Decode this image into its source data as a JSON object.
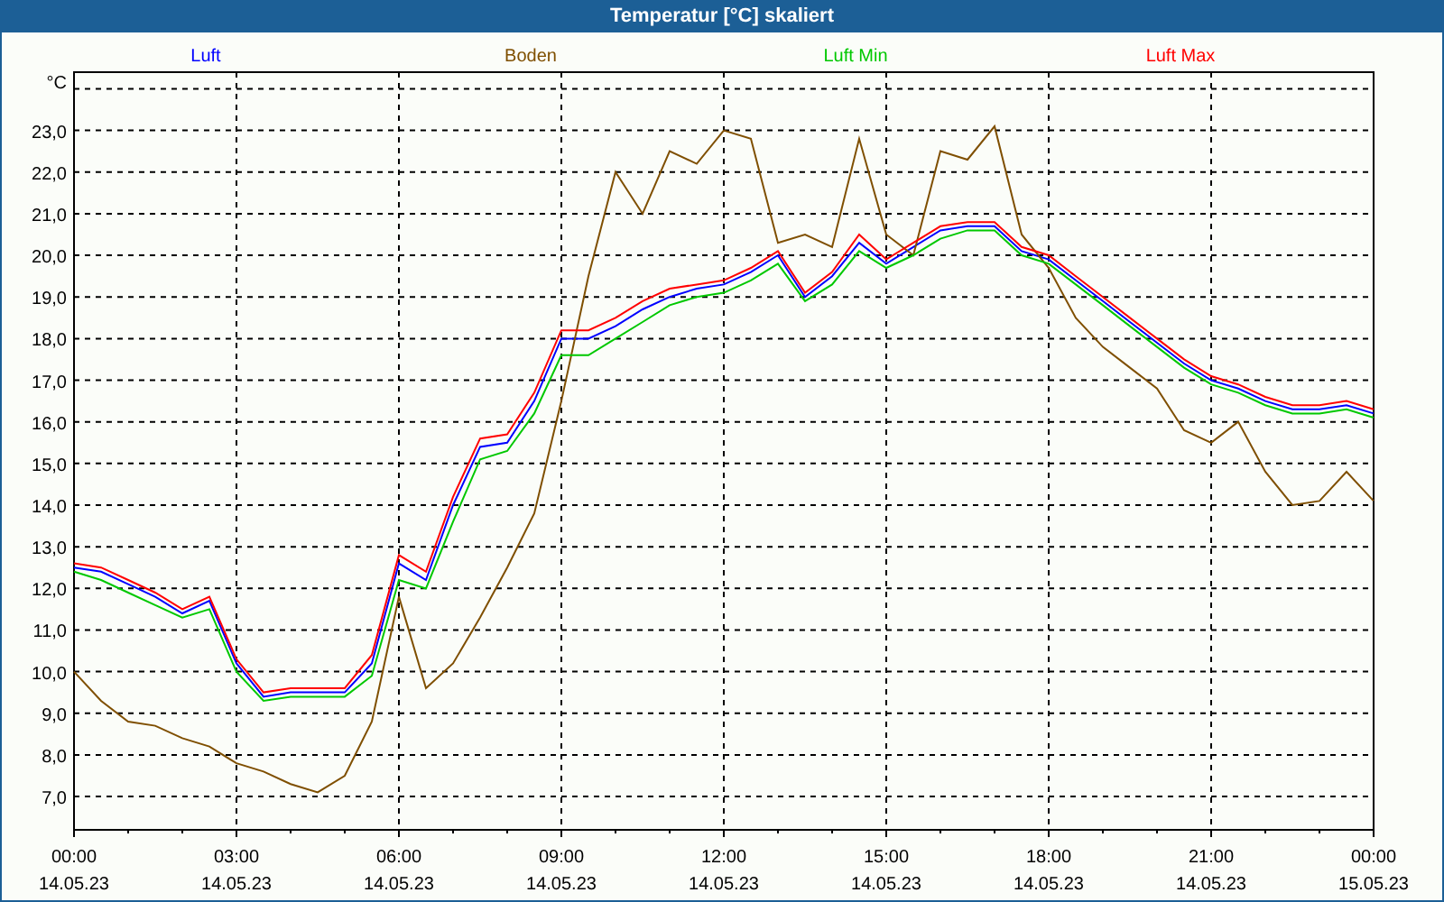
{
  "window": {
    "title": "Temperatur [°C] skaliert"
  },
  "chart_data": {
    "type": "line",
    "ylabel": "°C",
    "categories": [
      "00:00\n14.05.23",
      null,
      null,
      null,
      null,
      null,
      "03:00\n14.05.23",
      null,
      null,
      null,
      null,
      null,
      "06:00\n14.05.23",
      null,
      null,
      null,
      null,
      null,
      "09:00\n14.05.23",
      null,
      null,
      null,
      null,
      null,
      "12:00\n14.05.23",
      null,
      null,
      null,
      null,
      null,
      "15:00\n14.05.23",
      null,
      null,
      null,
      null,
      null,
      "18:00\n14.05.23",
      null,
      null,
      null,
      null,
      null,
      "21:00\n14.05.23",
      null,
      null,
      null,
      null,
      null,
      "00:00\n15.05.23"
    ],
    "series": [
      {
        "name": "Luft",
        "color": "#0000ff",
        "values": [
          12.5,
          12.4,
          12.1,
          11.8,
          11.4,
          11.7,
          10.2,
          9.4,
          9.5,
          9.5,
          9.5,
          10.2,
          12.6,
          12.2,
          14.0,
          15.4,
          15.5,
          16.5,
          18.0,
          18.0,
          18.3,
          18.7,
          19.0,
          19.2,
          19.3,
          19.6,
          20.0,
          19.0,
          19.5,
          20.3,
          19.8,
          20.2,
          20.6,
          20.7,
          20.7,
          20.1,
          19.9,
          19.4,
          18.9,
          18.4,
          17.9,
          17.4,
          17.0,
          16.8,
          16.5,
          16.3,
          16.3,
          16.4,
          16.2
        ]
      },
      {
        "name": "Boden",
        "color": "#7f4f00",
        "values": [
          10.0,
          9.3,
          8.8,
          8.7,
          8.4,
          8.2,
          7.8,
          7.6,
          7.3,
          7.1,
          7.5,
          8.8,
          11.8,
          9.6,
          10.2,
          11.3,
          12.5,
          13.8,
          16.5,
          19.5,
          22.0,
          21.0,
          22.5,
          22.2,
          23.0,
          22.8,
          20.3,
          20.5,
          20.2,
          22.8,
          20.5,
          20.0,
          22.5,
          22.3,
          23.1,
          20.5,
          19.7,
          18.5,
          17.8,
          17.3,
          16.8,
          15.8,
          15.5,
          16.0,
          14.8,
          14.0,
          14.1,
          14.8,
          14.1
        ]
      },
      {
        "name": "Luft Min",
        "color": "#00c800",
        "values": [
          12.4,
          12.2,
          11.9,
          11.6,
          11.3,
          11.5,
          10.0,
          9.3,
          9.4,
          9.4,
          9.4,
          9.9,
          12.2,
          12.0,
          13.6,
          15.1,
          15.3,
          16.2,
          17.6,
          17.6,
          18.0,
          18.4,
          18.8,
          19.0,
          19.1,
          19.4,
          19.8,
          18.9,
          19.3,
          20.1,
          19.7,
          20.0,
          20.4,
          20.6,
          20.6,
          20.0,
          19.8,
          19.3,
          18.8,
          18.3,
          17.8,
          17.3,
          16.9,
          16.7,
          16.4,
          16.2,
          16.2,
          16.3,
          16.1
        ]
      },
      {
        "name": "Luft Max",
        "color": "#ff0000",
        "values": [
          12.6,
          12.5,
          12.2,
          11.9,
          11.5,
          11.8,
          10.3,
          9.5,
          9.6,
          9.6,
          9.6,
          10.4,
          12.8,
          12.4,
          14.2,
          15.6,
          15.7,
          16.7,
          18.2,
          18.2,
          18.5,
          18.9,
          19.2,
          19.3,
          19.4,
          19.7,
          20.1,
          19.1,
          19.6,
          20.5,
          19.9,
          20.3,
          20.7,
          20.8,
          20.8,
          20.2,
          20.0,
          19.5,
          19.0,
          18.5,
          18.0,
          17.5,
          17.1,
          16.9,
          16.6,
          16.4,
          16.4,
          16.5,
          16.3
        ]
      }
    ],
    "ylim": [
      6.2,
      24.4
    ],
    "grid": true,
    "yticks": [
      {
        "value": 7,
        "label": "7,0"
      },
      {
        "value": 8,
        "label": "8,0"
      },
      {
        "value": 9,
        "label": "9,0"
      },
      {
        "value": 10,
        "label": "10,0"
      },
      {
        "value": 11,
        "label": "11,0"
      },
      {
        "value": 12,
        "label": "12,0"
      },
      {
        "value": 13,
        "label": "13,0"
      },
      {
        "value": 14,
        "label": "14,0"
      },
      {
        "value": 15,
        "label": "15,0"
      },
      {
        "value": 16,
        "label": "16,0"
      },
      {
        "value": 17,
        "label": "17,0"
      },
      {
        "value": 18,
        "label": "18,0"
      },
      {
        "value": 19,
        "label": "19,0"
      },
      {
        "value": 20,
        "label": "20,0"
      },
      {
        "value": 21,
        "label": "21,0"
      },
      {
        "value": 22,
        "label": "22,0"
      },
      {
        "value": 23,
        "label": "23,0"
      }
    ]
  }
}
